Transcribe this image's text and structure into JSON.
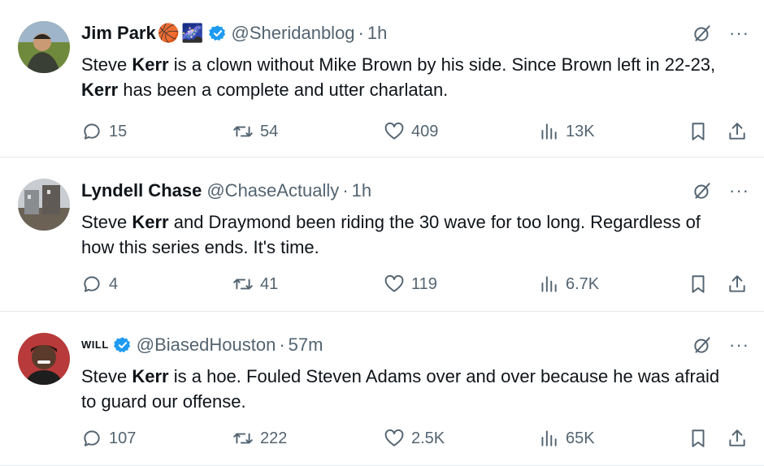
{
  "tweets": [
    {
      "name": "Jim Park",
      "emojis": [
        "🏀",
        "🌌"
      ],
      "verified": true,
      "handle": "@Sheridanblog",
      "time": "1h",
      "text": [
        {
          "t": "Steve ",
          "b": false
        },
        {
          "t": "Kerr",
          "b": true
        },
        {
          "t": " is a clown without Mike Brown by his side. Since Brown left in 22-23, ",
          "b": false
        },
        {
          "t": "Kerr",
          "b": true
        },
        {
          "t": " has been a complete and utter charlatan.",
          "b": false
        }
      ],
      "replies": "15",
      "retweets": "54",
      "likes": "409",
      "views": "13K"
    },
    {
      "name": "Lyndell Chase",
      "emojis": [],
      "verified": false,
      "handle": "@ChaseActually",
      "time": "1h",
      "text": [
        {
          "t": "Steve ",
          "b": false
        },
        {
          "t": "Kerr",
          "b": true
        },
        {
          "t": " and Draymond been riding the 30 wave for too long. Regardless of how this series ends. It's time.",
          "b": false
        }
      ],
      "replies": "4",
      "retweets": "41",
      "likes": "119",
      "views": "6.7K"
    },
    {
      "name": "WILL",
      "emojis": [],
      "verified": true,
      "handle": "@BiasedHouston",
      "time": "57m",
      "text": [
        {
          "t": "Steve ",
          "b": false
        },
        {
          "t": "Kerr",
          "b": true
        },
        {
          "t": " is a hoe. Fouled Steven Adams over and over because he was afraid to guard our offense.",
          "b": false
        }
      ],
      "replies": "107",
      "retweets": "222",
      "likes": "2.5K",
      "views": "65K"
    }
  ],
  "icons": {
    "reply": "reply-icon",
    "retweet": "retweet-icon",
    "like": "like-icon",
    "views": "views-icon",
    "bookmark": "bookmark-icon",
    "share": "share-icon",
    "grok": "grok-icon",
    "more": "more-icon",
    "verified": "verified-badge-icon"
  },
  "colors": {
    "text": "#0f1419",
    "secondary": "#536471",
    "verified": "#1d9bf0",
    "divider": "#e6e9ec"
  },
  "more_label": "···",
  "dot_separator": "·"
}
